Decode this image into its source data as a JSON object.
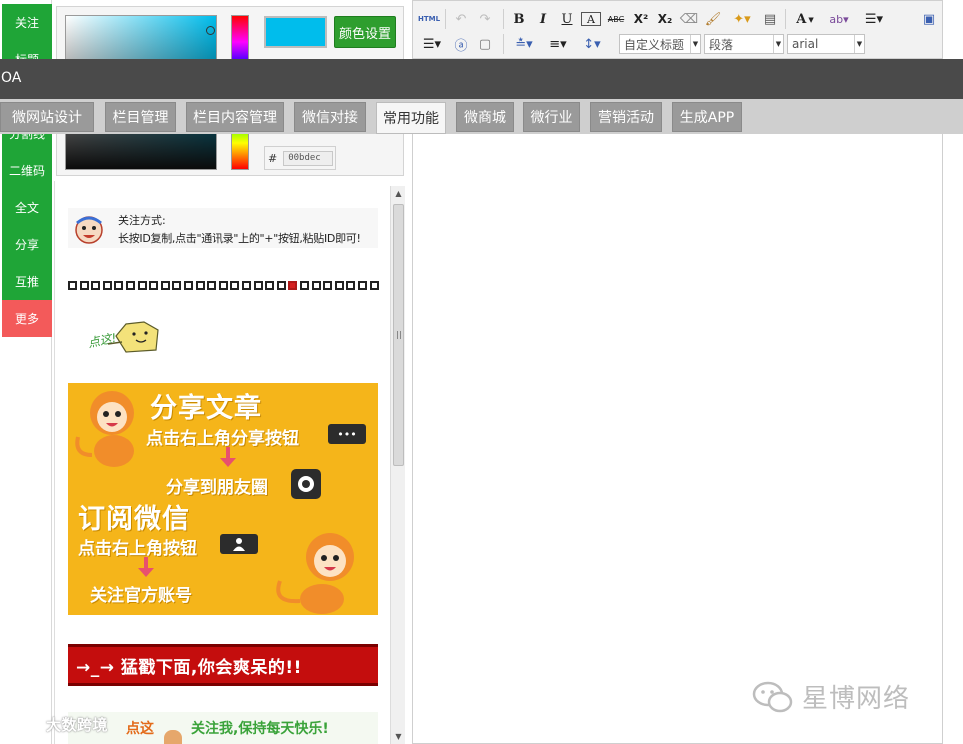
{
  "left_bar": {
    "items": [
      "关注",
      "标题",
      "分割线",
      "二维码",
      "全文",
      "分享",
      "互推",
      "更多"
    ]
  },
  "color_panel": {
    "current_color": "#00bdec",
    "set_button": "颜色设置",
    "hex_prefix": "#",
    "hex_value": "00bdec"
  },
  "templates": {
    "follow": {
      "title": "关注方式:",
      "desc": "长按ID复制,点击\"通讯录\"上的\"+\"按钮,粘贴ID即可!"
    },
    "share_poster": {
      "title_share": "分享文章",
      "sub_share": "点击右上角分享按钮",
      "sub_moments": "分享到朋友圈",
      "title_subscribe": "订阅微信",
      "sub_subscribe": "点击右上角按钮",
      "sub_follow": "关注官方账号",
      "share_btn_glyph": "•••"
    },
    "red_banner": "→_→  猛戳下面,你会爽呆的!!",
    "bottom_stripe_a": "点这",
    "bottom_stripe_b": "关注我,保持每天快乐!"
  },
  "editor": {
    "toolbar": {
      "html": "HTML",
      "bold": "B",
      "italic": "I",
      "underline": "U",
      "letter_a": "A",
      "strike": "ABC",
      "sup": "X²",
      "sub": "X₂",
      "font_color": "A",
      "custom_title": "自定义标题",
      "paragraph": "段落",
      "font": "arial"
    }
  },
  "oa_bar": {
    "label": "OA"
  },
  "nav_tabs": [
    "微网站设计",
    "栏目管理",
    "栏目内容管理",
    "微信对接",
    "常用功能",
    "微商城",
    "微行业",
    "营销活动",
    "生成APP"
  ],
  "nav_active": "常用功能",
  "watermarks": {
    "left": "大数跨境",
    "right": "星博网络"
  },
  "colors": {
    "category_green": "#1fa537",
    "more_red": "#f35a5a",
    "oa_dark": "#4a4a4a",
    "tab_gray": "#9a9a9a",
    "poster_yellow": "#f5b51a",
    "banner_red": "#c40d0d"
  }
}
